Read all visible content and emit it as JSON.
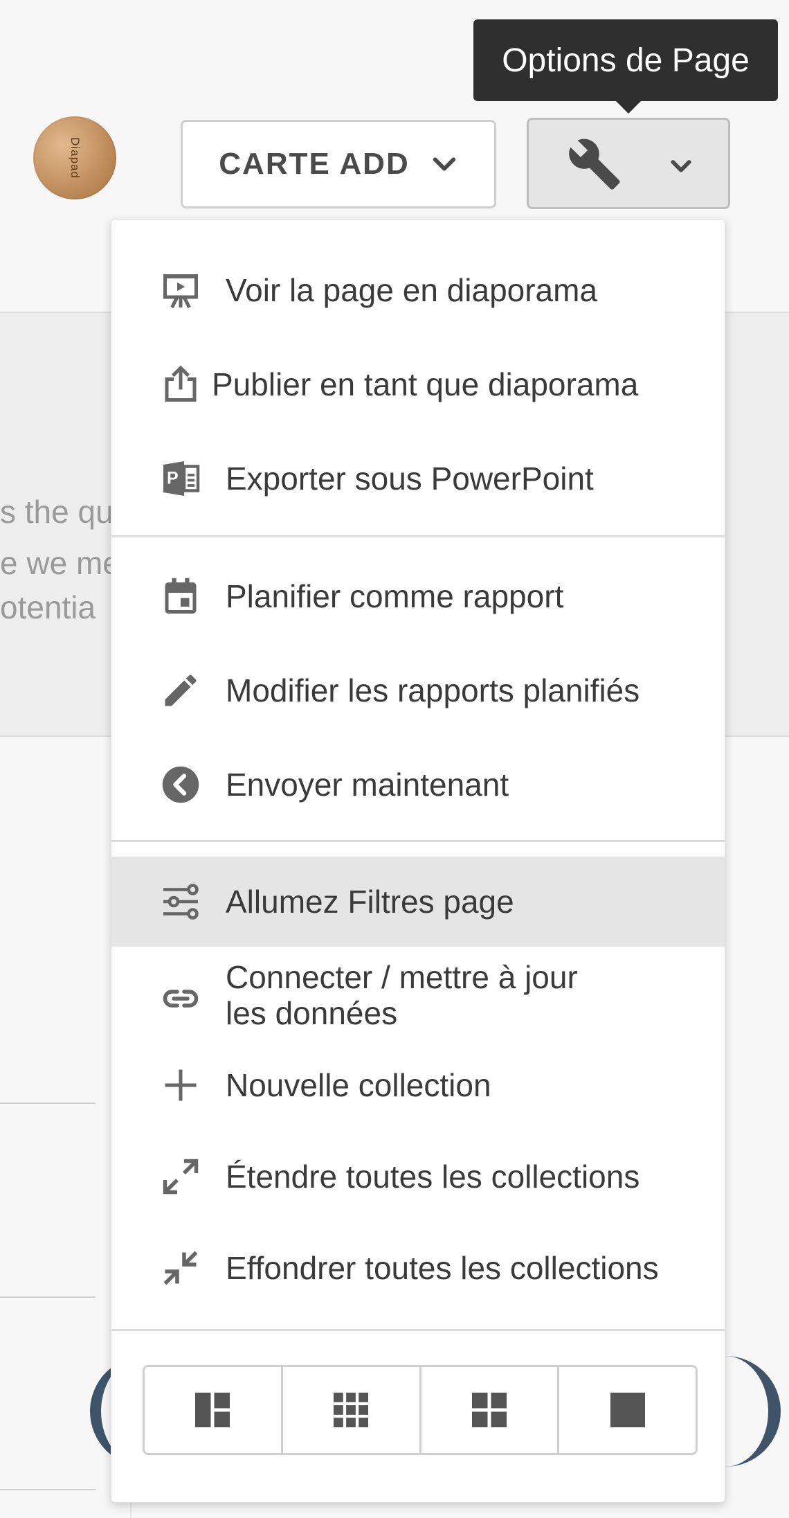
{
  "header": {
    "avatar_text": "Diapad",
    "add_card_label": "CARTE ADD",
    "tooltip": "Options de Page"
  },
  "background": {
    "fragments": [
      "s the qu",
      "e we me",
      "otentia"
    ]
  },
  "menu": {
    "items": [
      {
        "label": "Voir la page en diaporama",
        "icon": "slideshow-icon"
      },
      {
        "label": "Publier en tant que diaporama",
        "icon": "share-upload-icon"
      },
      {
        "label": "Exporter sous PowerPoint",
        "icon": "powerpoint-icon"
      },
      {
        "label": "Planifier comme rapport",
        "icon": "calendar-icon"
      },
      {
        "label": "Modifier les rapports planifiés",
        "icon": "pencil-icon"
      },
      {
        "label": "Envoyer maintenant",
        "icon": "chevron-left-circle-icon"
      },
      {
        "label": "Allumez Filtres page",
        "icon": "filter-sliders-icon",
        "highlighted": true
      },
      {
        "label_line1": "Connecter / mettre à jour",
        "label_line2": "les données",
        "icon": "link-icon"
      },
      {
        "label": "Nouvelle collection",
        "icon": "plus-icon"
      },
      {
        "label": "Étendre toutes les collections",
        "icon": "expand-icon"
      },
      {
        "label": "Effondrer toutes les collections",
        "icon": "collapse-icon"
      }
    ],
    "layouts": [
      "layout-mixed-icon",
      "layout-grid-small-icon",
      "layout-grid-large-icon",
      "layout-single-icon"
    ]
  },
  "colors": {
    "accent_dark": "#3f5468",
    "highlight": "#e5e5e5",
    "tooltip_bg": "#2f2f2f"
  }
}
